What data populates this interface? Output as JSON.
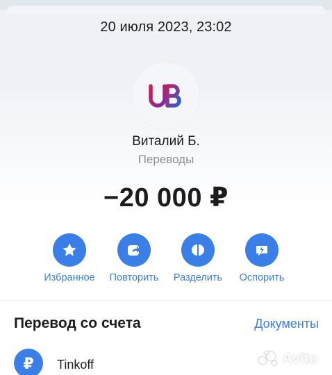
{
  "header": {
    "date": "20 июля 2023, 23:02"
  },
  "merchant": {
    "logo_text": "UB",
    "name": "Виталий Б.",
    "category": "Переводы"
  },
  "amount": "−20 000 ₽",
  "actions": [
    {
      "label": "Избранное",
      "icon": "star-icon"
    },
    {
      "label": "Повторить",
      "icon": "repeat-arrow-icon"
    },
    {
      "label": "Разделить",
      "icon": "split-icon"
    },
    {
      "label": "Оспорить",
      "icon": "dispute-icon"
    }
  ],
  "source": {
    "title": "Перевод со счета",
    "documents_link": "Документы",
    "account_name": "Tinkoff",
    "account_icon": "₽"
  },
  "watermark": {
    "text": "Avito"
  },
  "colors": {
    "accent": "#3a7ee8",
    "logo_red": "#d4194b",
    "logo_blue": "#2a5fd6"
  }
}
